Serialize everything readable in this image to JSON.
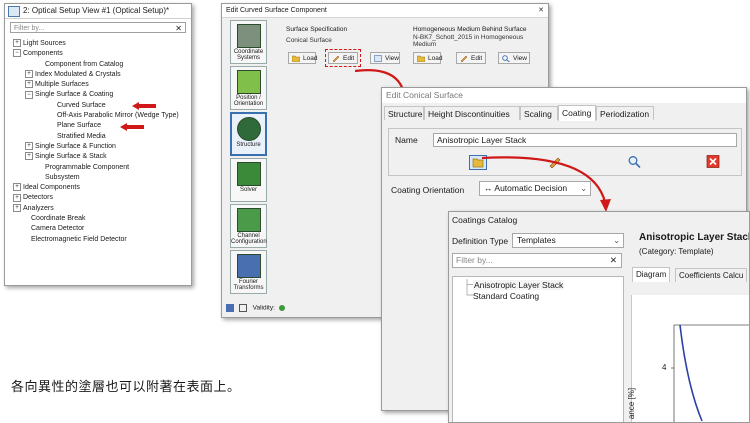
{
  "tree_panel": {
    "title": "2: Optical Setup View #1 (Optical Setup)*",
    "filter_placeholder": "Filter by...",
    "filter_clear": "✕",
    "items": [
      {
        "label": "Light Sources",
        "expander": "⊞"
      },
      {
        "label": "Components",
        "expander": "⊟"
      },
      {
        "label": "Component from Catalog",
        "expander": ""
      },
      {
        "label": "Index Modulated & Crystals",
        "expander": "⊞"
      },
      {
        "label": "Multiple Surfaces",
        "expander": "⊞"
      },
      {
        "label": "Single Surface & Coating",
        "expander": "⊟"
      },
      {
        "label": "Curved Surface",
        "expander": ""
      },
      {
        "label": "Off-Axis Parabolic Mirror (Wedge Type)",
        "expander": ""
      },
      {
        "label": "Plane Surface",
        "expander": ""
      },
      {
        "label": "Stratified Media",
        "expander": ""
      },
      {
        "label": "Single Surface & Function",
        "expander": "⊞"
      },
      {
        "label": "Single Surface & Stack",
        "expander": "⊞"
      },
      {
        "label": "Programmable Component",
        "expander": ""
      },
      {
        "label": "Subsystem",
        "expander": ""
      },
      {
        "label": "Ideal Components",
        "expander": "⊞"
      },
      {
        "label": "Detectors",
        "expander": "⊞"
      },
      {
        "label": "Analyzers",
        "expander": "⊞"
      },
      {
        "label": "Coordinate Break",
        "expander": ""
      },
      {
        "label": "Camera Detector",
        "expander": ""
      },
      {
        "label": "Electromagnetic Field Detector",
        "expander": ""
      }
    ]
  },
  "curved_surface_dialog": {
    "title": "Edit Curved Surface Component",
    "window_controls": "✕",
    "left_tabs": [
      "Coordinate Systems",
      "Position / Orientation",
      "Structure",
      "Solver",
      "Channel Configuration",
      "Fourier Transforms"
    ],
    "surface_spec_header": "Surface Specification",
    "surface_spec_value": "Conical Surface",
    "medium_header": "Homogeneous Medium Behind Surface",
    "medium_value": "N-BK7_Schott_2015 in Homogeneous Medium",
    "load_label": "Load",
    "edit_label": "Edit",
    "view_label": "View",
    "validity_label": "Validity:"
  },
  "conical_dialog": {
    "title": "Edit Conical Surface",
    "tabs": [
      "Structure",
      "Height Discontinuities",
      "Scaling",
      "Coating",
      "Periodization"
    ],
    "active_tab": "Coating",
    "name_label": "Name",
    "name_value": "Anisotropic Layer Stack",
    "orientation_label": "Coating Orientation",
    "orientation_value": "Automatic Decision",
    "orientation_prefix": "↔",
    "dropdown_glyph": "⌄"
  },
  "coatings_catalog": {
    "title": "Coatings Catalog",
    "definition_label": "Definition Type",
    "definition_value": "Templates",
    "filter_placeholder": "Filter by...",
    "filter_clear": "✕",
    "items": [
      "Anisotropic Layer Stack",
      "Standard Coating"
    ],
    "detail_title": "Anisotropic Layer Stack",
    "detail_category": "(Category: Template)",
    "detail_tabs": [
      "Diagram",
      "Coefficients Calcu"
    ],
    "axis_tick": "4",
    "axis_label": "ance [%]"
  },
  "caption": "各向異性的塗層也可以附著在表面上。",
  "colors": {
    "annotation_red": "#d01818",
    "selection_blue": "#3a6fb0"
  }
}
